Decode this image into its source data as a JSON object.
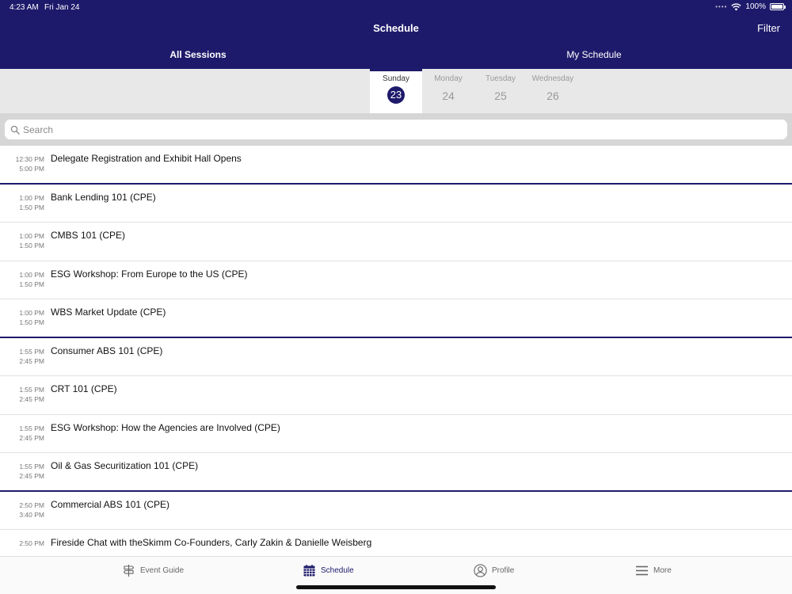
{
  "status": {
    "time": "4:23 AM",
    "date": "Fri Jan 24",
    "battery": "100%",
    "battery_level": 1.0
  },
  "nav": {
    "title": "Schedule",
    "filter_label": "Filter"
  },
  "segments": {
    "all": "All Sessions",
    "my": "My Schedule"
  },
  "days": [
    {
      "name": "Sunday",
      "num": "23",
      "selected": true
    },
    {
      "name": "Monday",
      "num": "24"
    },
    {
      "name": "Tuesday",
      "num": "25"
    },
    {
      "name": "Wednesday",
      "num": "26"
    }
  ],
  "search": {
    "placeholder": "Search"
  },
  "sessions": [
    {
      "start": "12:30 PM",
      "end": "5:00 PM",
      "title": "Delegate Registration and Exhibit Hall Opens"
    },
    {
      "start": "1:00 PM",
      "end": "1:50 PM",
      "title": "Bank Lending 101 (CPE)"
    },
    {
      "start": "1:00 PM",
      "end": "1:50 PM",
      "title": "CMBS 101 (CPE)"
    },
    {
      "start": "1:00 PM",
      "end": "1:50 PM",
      "title": "ESG Workshop: From Europe to the US (CPE)"
    },
    {
      "start": "1:00 PM",
      "end": "1:50 PM",
      "title": "WBS Market Update (CPE)"
    },
    {
      "start": "1:55 PM",
      "end": "2:45 PM",
      "title": "Consumer ABS 101 (CPE)"
    },
    {
      "start": "1:55 PM",
      "end": "2:45 PM",
      "title": "CRT 101 (CPE)"
    },
    {
      "start": "1:55 PM",
      "end": "2:45 PM",
      "title": "ESG Workshop: How the Agencies are Involved (CPE)"
    },
    {
      "start": "1:55 PM",
      "end": "2:45 PM",
      "title": "Oil & Gas Securitization 101 (CPE)"
    },
    {
      "start": "2:50 PM",
      "end": "3:40 PM",
      "title": "Commercial ABS 101 (CPE)"
    },
    {
      "start": "2:50 PM",
      "end": "",
      "title": "Fireside Chat with theSkimm Co-Founders, Carly Zakin & Danielle Weisberg"
    }
  ],
  "tabs": [
    {
      "label": "Event Guide",
      "icon": "signpost-icon"
    },
    {
      "label": "Schedule",
      "icon": "calendar-icon",
      "active": true
    },
    {
      "label": "Profile",
      "icon": "profile-icon"
    },
    {
      "label": "More",
      "icon": "menu-icon"
    }
  ],
  "colors": {
    "accent": "#1e1a6b",
    "day_bar": "#e8e8e8",
    "search_bar": "#d6d6d6"
  }
}
